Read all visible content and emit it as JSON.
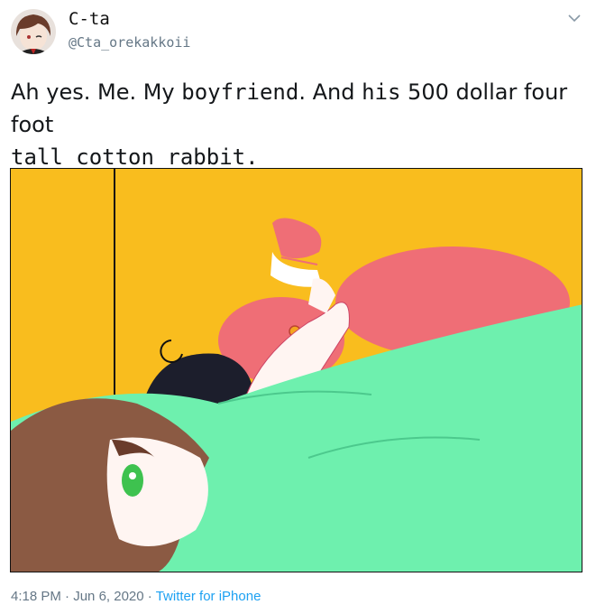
{
  "tweet": {
    "display_name": "C-ta",
    "handle": "@Cta_orekakkoii",
    "text_part1": "Ah yes. Me. My ",
    "text_part2": "boyfriend",
    "text_part3": ". And ",
    "text_part4": "his",
    "text_part5": " 500 dollar four foot",
    "text_line2": "tall cotton rabbit.",
    "time": "4:18 PM",
    "separator": " · ",
    "date": "Jun 6, 2020",
    "separator2": " · ",
    "source": "Twitter for iPhone"
  },
  "icons": {
    "caret": "chevron-down-icon",
    "avatar": "avatar"
  },
  "colors": {
    "wall": "#f9bd1e",
    "blanket": "#6ef0ae",
    "rabbit": "#ef6e76",
    "link": "#1da1f2",
    "muted": "#657786"
  }
}
